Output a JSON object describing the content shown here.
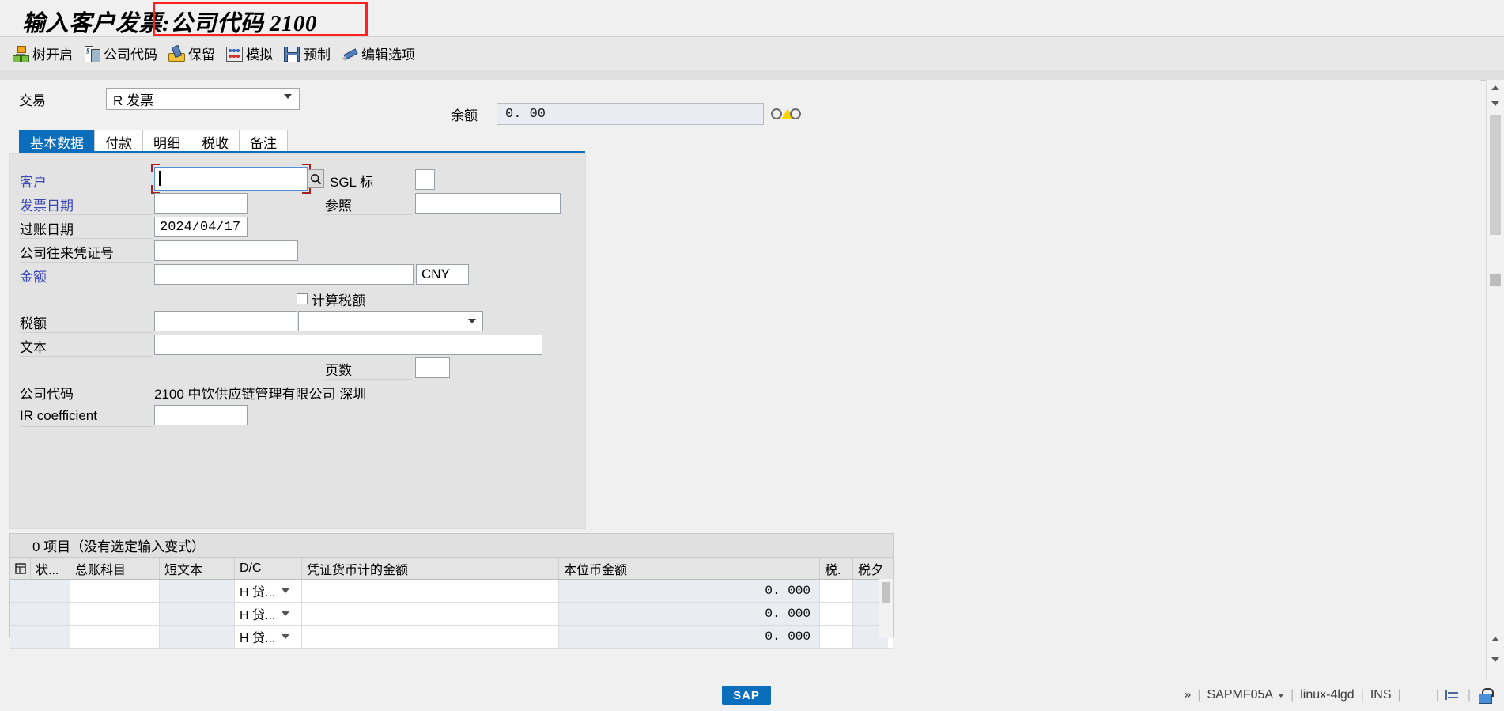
{
  "window": {
    "title_prefix": "输入客户发票:",
    "title_highlight": "公司代码 2100"
  },
  "toolbar": {
    "items": [
      {
        "label": "树开启",
        "icon": "tree-icon"
      },
      {
        "label": "公司代码",
        "icon": "company-code-icon"
      },
      {
        "label": "保留",
        "icon": "hold-icon"
      },
      {
        "label": "模拟",
        "icon": "simulate-icon"
      },
      {
        "label": "预制",
        "icon": "park-icon"
      },
      {
        "label": "编辑选项",
        "icon": "edit-options-icon"
      }
    ]
  },
  "transaction": {
    "label": "交易",
    "value": "R 发票"
  },
  "balance": {
    "label": "余额",
    "value": "0. 00"
  },
  "tabs": [
    {
      "label": "基本数据",
      "active": true
    },
    {
      "label": "付款",
      "active": false
    },
    {
      "label": "明细",
      "active": false
    },
    {
      "label": "税收",
      "active": false
    },
    {
      "label": "备注",
      "active": false
    }
  ],
  "form": {
    "customer": {
      "label": "客户",
      "value": ""
    },
    "sgl_indicator": {
      "label": "SGL 标",
      "value": ""
    },
    "invoice_date": {
      "label": "发票日期",
      "value": ""
    },
    "reference": {
      "label": "参照",
      "value": ""
    },
    "posting_date": {
      "label": "过账日期",
      "value": "2024/04/17"
    },
    "cross_company_doc": {
      "label": "公司往来凭证号",
      "value": ""
    },
    "amount": {
      "label": "金额",
      "value": "",
      "currency": "CNY"
    },
    "calculate_tax": {
      "label": "计算税额",
      "checked": false
    },
    "tax_amount": {
      "label": "税额",
      "value": "",
      "tax_code": ""
    },
    "text": {
      "label": "文本",
      "value": ""
    },
    "pages": {
      "label": "页数",
      "value": ""
    },
    "company_code": {
      "label": "公司代码",
      "value": "2100 中饮供应链管理有限公司 深圳"
    },
    "ir_coefficient": {
      "label": "IR coefficient",
      "value": ""
    }
  },
  "items": {
    "header": "0 项目（没有选定输入变式）",
    "columns": [
      "状...",
      "总账科目",
      "短文本",
      "D/C",
      "凭证货币计的金额",
      "本位币金额",
      "税.",
      "税夕"
    ],
    "rows": [
      {
        "status": "",
        "gl_account": "",
        "short_text": "",
        "dc": "H 贷...",
        "doc_currency_amount": "",
        "local_currency_amount": "0. 000",
        "tax": "",
        "tax2": ""
      },
      {
        "status": "",
        "gl_account": "",
        "short_text": "",
        "dc": "H 贷...",
        "doc_currency_amount": "",
        "local_currency_amount": "0. 000",
        "tax": "",
        "tax2": ""
      },
      {
        "status": "",
        "gl_account": "",
        "short_text": "",
        "dc": "H 贷...",
        "doc_currency_amount": "",
        "local_currency_amount": "0. 000",
        "tax": "",
        "tax2": ""
      }
    ]
  },
  "statusbar": {
    "logo": "SAP",
    "expand": "»",
    "program": "SAPMF05A",
    "server": "linux-4lgd",
    "insert_mode": "INS"
  },
  "colors": {
    "accent": "#0a6ebd",
    "highlight_box": "#ff2020",
    "focus_border": "#4f8fd6",
    "focus_corner": "#a32020",
    "link_label": "#3b47b5",
    "warning": "#ffd400"
  }
}
